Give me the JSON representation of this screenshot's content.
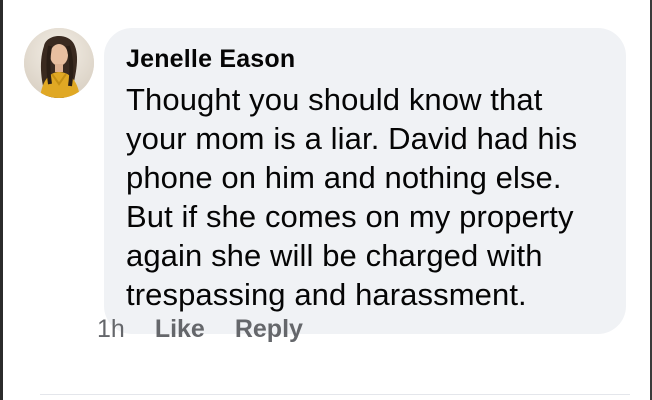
{
  "comment": {
    "author": "Jenelle Eason",
    "avatar_icon": "profile-photo",
    "text": "Thought you should know that\nyour mom is a liar. David had his\nphone on him and nothing else.\nBut if she comes on my property\nagain she will be charged with\ntrespassing and harassment.",
    "timestamp": "1h",
    "like_label": "Like",
    "reply_label": "Reply"
  },
  "colors": {
    "bubble_background": "#f0f2f5",
    "author_text": "#050505",
    "meta_text": "#65676b"
  }
}
